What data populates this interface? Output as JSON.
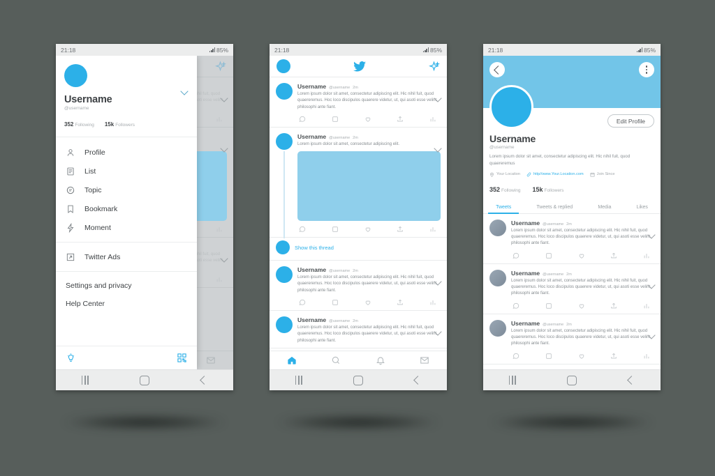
{
  "statusbar": {
    "time": "21:18",
    "battery": "85%"
  },
  "drawer": {
    "name": "Username",
    "handle": "@username",
    "following_count": "352",
    "following_label": "Following",
    "followers_count": "15k",
    "followers_label": "Followers",
    "menu": [
      {
        "label": "Profile",
        "icon": "person-icon"
      },
      {
        "label": "List",
        "icon": "list-icon"
      },
      {
        "label": "Topic",
        "icon": "topic-icon"
      },
      {
        "label": "Bookmark",
        "icon": "bookmark-icon"
      },
      {
        "label": "Moment",
        "icon": "moment-icon"
      }
    ],
    "ads_label": "Twitter Ads",
    "ads_icon": "external-link-icon",
    "links": [
      "Settings and privacy",
      "Help Center"
    ],
    "footer_icons": [
      "lightbulb-icon",
      "qr-code-icon"
    ]
  },
  "timeline": {
    "logo": "twitter-bird-icon",
    "sparkle": "sparkle-icon",
    "show_thread": "Show this thread",
    "tweets": [
      {
        "name": "Username",
        "handle": "@username",
        "time": "2m",
        "text": "Lorem ipsum dolor sit amet, consectetur adipiscing elit. Hic nihil fuit, quod quaereremus. Hoc loco discipulos quaerere videtur, ut, qui asoti esse velint, philosophi ante fiant.",
        "has_media": false
      },
      {
        "name": "Username",
        "handle": "@username",
        "time": "2m",
        "text": "Lorem ipsum dolor sit amet, consectetur adipiscing elit.",
        "has_media": true
      },
      {
        "name": "Username",
        "handle": "@username",
        "time": "2m",
        "text": "Lorem ipsum dolor sit amet, consectetur adipiscing elit. Hic nihil fuit, quod quaereremus. Hoc loco discipulos quaerere videtur, ut, qui asoti esse velint, philosophi ante fiant.",
        "has_media": false
      },
      {
        "name": "Username",
        "handle": "@username",
        "time": "2m",
        "text": "Lorem ipsum dolor sit amet, consectetur adipiscing elit. Hic nihil fuit, quod quaereremus. Hoc loco discipulos quaerere videtur, ut, qui asoti esse velint, philosophi ante fiant.",
        "has_media": false
      }
    ],
    "actions": [
      "reply-icon",
      "retweet-icon",
      "like-icon",
      "share-icon",
      "analytics-icon"
    ],
    "bottom_nav": [
      "home-icon",
      "search-icon",
      "notifications-icon",
      "messages-icon"
    ]
  },
  "profile": {
    "back_icon": "back-arrow-icon",
    "more_icon": "more-options-icon",
    "edit_button": "Edit Profile",
    "name": "Username",
    "handle": "@username",
    "bio": "Lorem ipsum dolor sit amet, consectetur adipiscing elit. Hic nihil fuit, quod quaereremus",
    "location": "Your Location",
    "website": "http//www.Your.Location.com",
    "join": "Join Since",
    "following_count": "352",
    "following_label": "Following",
    "followers_count": "15k",
    "followers_label": "Followers",
    "tabs": [
      "Tweets",
      "Tweets & replied",
      "Media",
      "Likes"
    ],
    "active_tab": "Tweets",
    "tweets": [
      {
        "name": "Username",
        "handle": "@username",
        "time": "2m",
        "text": "Lorem ipsum dolor sit amet, consectetur adipiscing elit. Hic nihil fuit, quod quaereremus. Hoc loco discipulos quaerere videtur, ut, qui asoti esse velint, philosophi ante fiant."
      },
      {
        "name": "Username",
        "handle": "@username",
        "time": "2m",
        "text": "Lorem ipsum dolor sit amet, consectetur adipiscing elit. Hic nihil fuit, quod quaereremus. Hoc loco discipulos quaerere videtur, ut, qui asoti esse velint, philosophi ante fiant."
      },
      {
        "name": "Username",
        "handle": "@username",
        "time": "2m",
        "text": "Lorem ipsum dolor sit amet, consectetur adipiscing elit. Hic nihil fuit, quod quaereremus. Hoc loco discipulos quaerere videtur, ut, qui asoti esse velint, philosophi ante fiant."
      }
    ]
  },
  "colors": {
    "brand": "#2cb0e8",
    "banner": "#72c5e8",
    "page_bg": "#575e5b"
  }
}
